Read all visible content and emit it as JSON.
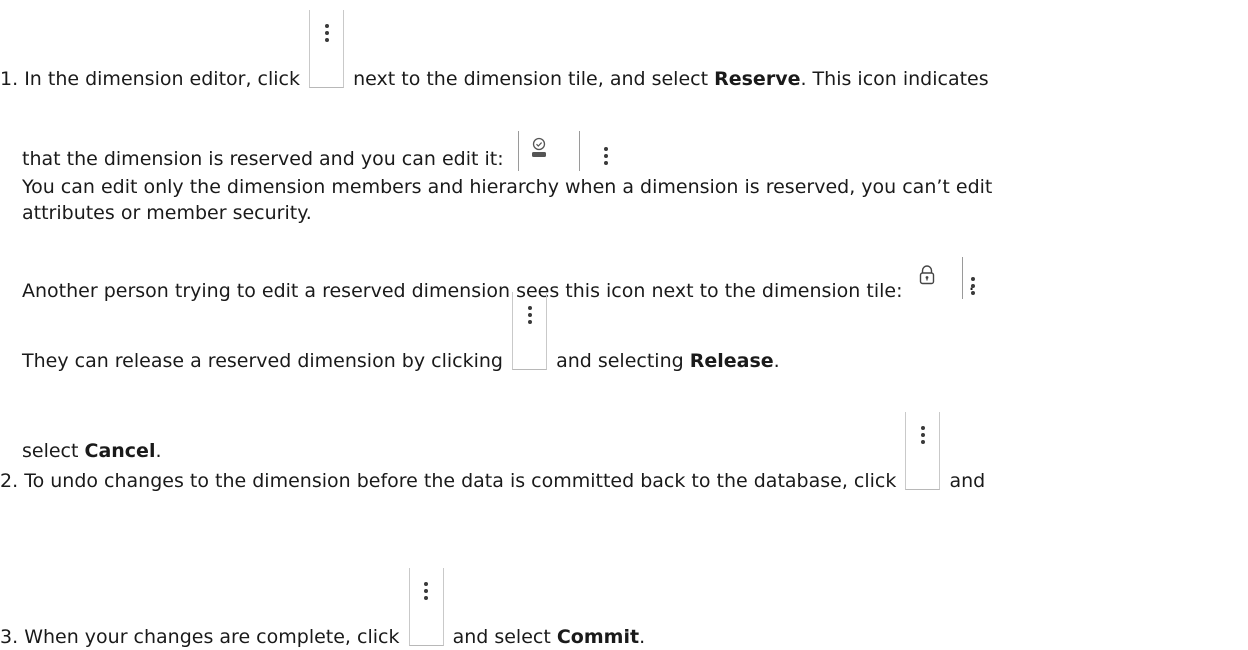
{
  "steps": [
    {
      "number": "1.",
      "line1_before": "In the dimension editor, click",
      "line1_after": "next to the dimension tile, and select",
      "line1_bold": "Reserve",
      "line1_tail": ". This icon indicates",
      "line2": "that the dimension is reserved and you can edit it:",
      "para2_line1": "You can edit only the dimension members and hierarchy when a dimension is reserved, you can’t edit",
      "para2_line2": "attributes or member security.",
      "para3": "Another person trying to edit a reserved dimension sees this icon next to the dimension tile:",
      "para3_end": ".",
      "para4_before": "They can release a reserved dimension by clicking",
      "para4_after": "and selecting",
      "para4_bold": "Release",
      "para4_tail": "."
    },
    {
      "number": "2.",
      "line1": "To undo changes to the dimension before the data is committed back to the database, click",
      "line1_after": "and",
      "line2_before": "select",
      "line2_bold": "Cancel",
      "line2_tail": "."
    },
    {
      "number": "3.",
      "before": "When your changes are complete, click",
      "after": "and select",
      "bold": "Commit",
      "tail": "."
    }
  ],
  "icons": {
    "menu": "kebab-menu-icon",
    "reserved": "reserved-user-icon",
    "locked": "lock-icon"
  }
}
